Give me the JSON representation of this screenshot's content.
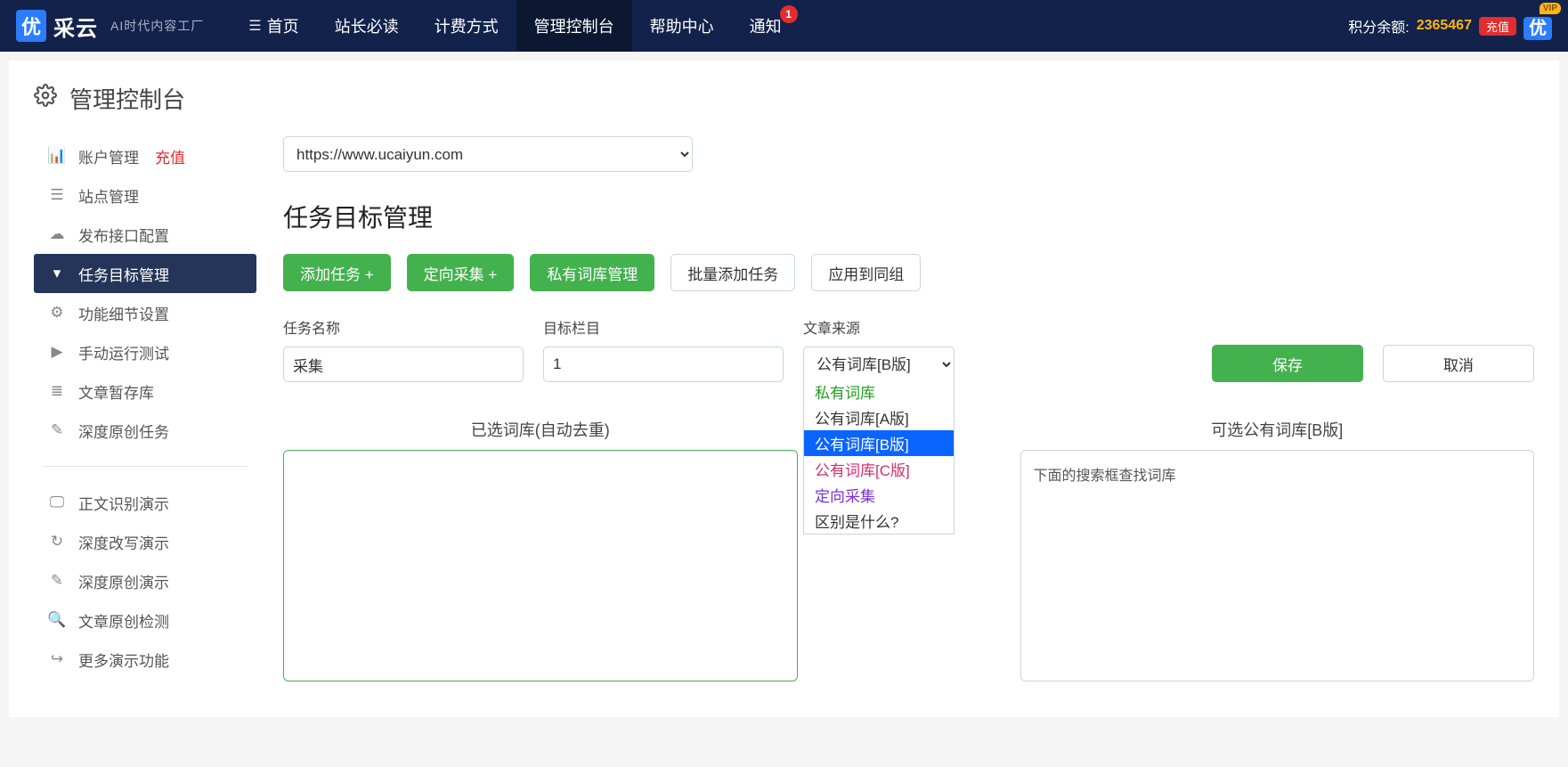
{
  "header": {
    "logo_badge": "优",
    "logo_text": "采云",
    "logo_sub": "AI时代内容工厂",
    "menu": [
      {
        "label": "首页"
      },
      {
        "label": "站长必读"
      },
      {
        "label": "计费方式"
      },
      {
        "label": "管理控制台"
      },
      {
        "label": "帮助中心"
      },
      {
        "label": "通知",
        "badge": "1"
      }
    ],
    "points_label": "积分余额:",
    "points_value": "2365467",
    "recharge": "充值",
    "vip_icon": "优",
    "vip_tag": "VIP"
  },
  "page_title": "管理控制台",
  "sidebar": {
    "group1": [
      {
        "icon": "chart-bar-icon",
        "glyph": "📊",
        "label": "账户管理",
        "extra": "充值"
      },
      {
        "icon": "list-icon",
        "glyph": "☰",
        "label": "站点管理"
      },
      {
        "icon": "cloud-icon",
        "glyph": "☁",
        "label": "发布接口配置"
      },
      {
        "icon": "filter-icon",
        "glyph": "▾",
        "label": "任务目标管理",
        "active": true
      },
      {
        "icon": "cogs-icon",
        "glyph": "⚙",
        "label": "功能细节设置"
      },
      {
        "icon": "play-icon",
        "glyph": "▶",
        "label": "手动运行测试"
      },
      {
        "icon": "stack-icon",
        "glyph": "≣",
        "label": "文章暂存库"
      },
      {
        "icon": "edit-icon",
        "glyph": "✎",
        "label": "深度原创任务"
      }
    ],
    "group2": [
      {
        "icon": "monitor-icon",
        "glyph": "🖵",
        "label": "正文识别演示"
      },
      {
        "icon": "refresh-icon",
        "glyph": "↻",
        "label": "深度改写演示"
      },
      {
        "icon": "edit-icon",
        "glyph": "✎",
        "label": "深度原创演示"
      },
      {
        "icon": "search-icon",
        "glyph": "🔍",
        "label": "文章原创检测"
      },
      {
        "icon": "share-icon",
        "glyph": "↪",
        "label": "更多演示功能"
      }
    ]
  },
  "main": {
    "site_url": "https://www.ucaiyun.com",
    "section_title": "任务目标管理",
    "buttons": {
      "add_task": "添加任务 +",
      "directed_collect": "定向采集 +",
      "private_lexicon": "私有词库管理",
      "batch_add": "批量添加任务",
      "apply_group": "应用到同组"
    },
    "form": {
      "task_name_label": "任务名称",
      "task_name_value": "采集",
      "target_column_label": "目标栏目",
      "target_column_value": "1",
      "article_source_label": "文章来源",
      "article_source_value": "公有词库[B版]",
      "save": "保存",
      "cancel": "取消",
      "source_options": [
        {
          "label": "私有词库",
          "cls": "green"
        },
        {
          "label": "公有词库[A版]",
          "cls": ""
        },
        {
          "label": "公有词库[B版]",
          "cls": "selected"
        },
        {
          "label": "公有词库[C版]",
          "cls": "red"
        },
        {
          "label": "定向采集",
          "cls": "purple"
        },
        {
          "label": "区别是什么?",
          "cls": ""
        }
      ]
    },
    "lists": {
      "left_title": "已选词库(自动去重)",
      "right_title": "可选公有词库[B版]",
      "right_hint": "下面的搜索框查找词库"
    }
  }
}
